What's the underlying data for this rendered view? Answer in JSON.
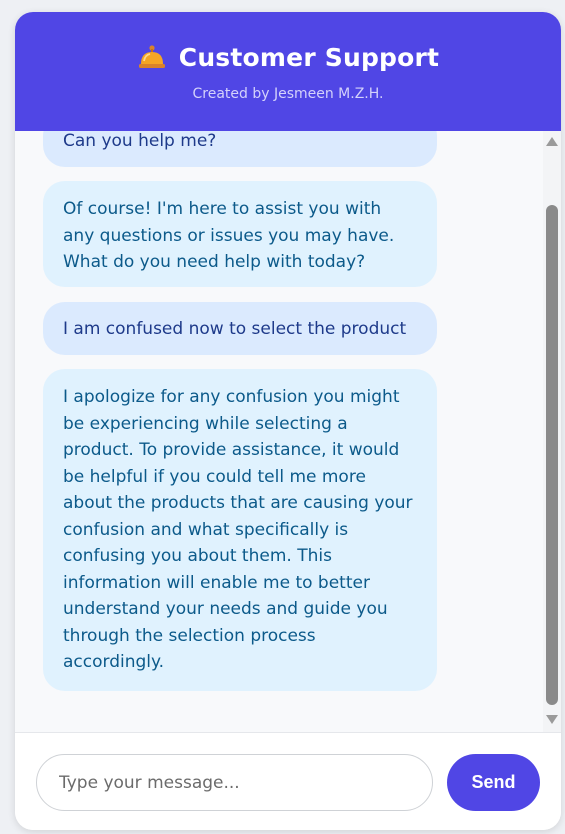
{
  "header": {
    "icon": "bell-icon",
    "title": "Customer Support",
    "subtitle": "Created by Jesmeen M.Z.H."
  },
  "messages": [
    {
      "role": "user",
      "text": "Can you help me?"
    },
    {
      "role": "bot",
      "text": "Of course! I'm here to assist you with any questions or issues you may have. What do you need help with today?"
    },
    {
      "role": "user",
      "text": "I am confused now to select the product"
    },
    {
      "role": "bot",
      "text": "I apologize for any confusion you might be experiencing while selecting a product. To provide assistance, it would be helpful if you could tell me more about the products that are causing your confusion and what specifically is confusing you about them. This information will enable me to better understand your needs and guide you through the selection process accordingly."
    }
  ],
  "composer": {
    "placeholder": "Type your message...",
    "value": "",
    "send_label": "Send"
  },
  "colors": {
    "accent": "#5046e5",
    "user_bubble": "#dbeafe",
    "bot_bubble": "#e0f2fe"
  }
}
